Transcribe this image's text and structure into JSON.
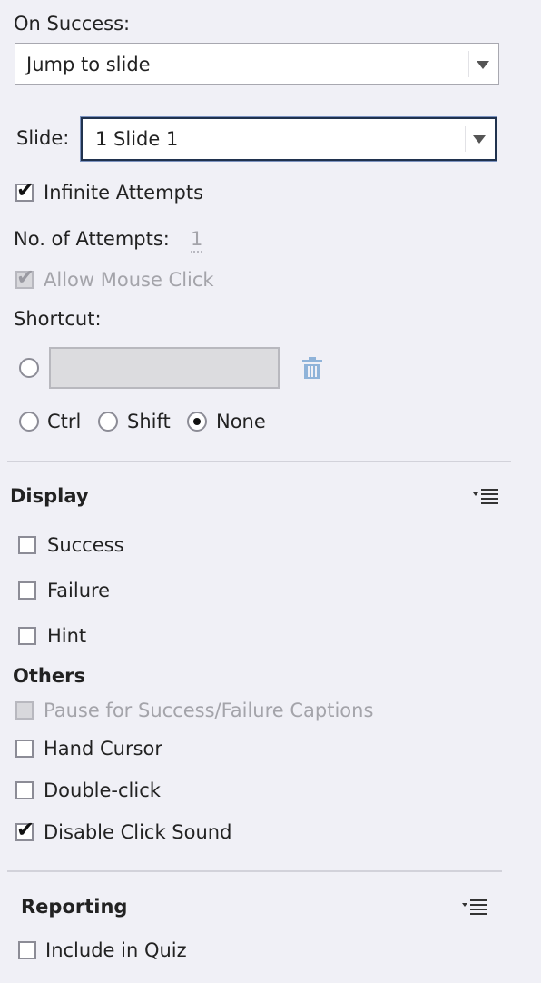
{
  "on_success": {
    "label": "On Success:",
    "value": "Jump to slide"
  },
  "slide": {
    "label": "Slide:",
    "value": "1 Slide 1"
  },
  "infinite_attempts": {
    "label": "Infinite Attempts",
    "checked": true
  },
  "attempts": {
    "label": "No. of Attempts:",
    "value": "1"
  },
  "allow_mouse_click": {
    "label": "Allow Mouse Click",
    "checked": true,
    "disabled": true
  },
  "shortcut": {
    "label": "Shortcut:",
    "key_value": "",
    "delete_icon": "trash-icon",
    "modifiers": [
      {
        "label": "Ctrl",
        "selected": false
      },
      {
        "label": "Shift",
        "selected": false
      },
      {
        "label": "None",
        "selected": true
      }
    ]
  },
  "display": {
    "title": "Display",
    "menu_icon": "panel-menu-icon",
    "items": [
      {
        "label": "Success",
        "checked": false
      },
      {
        "label": "Failure",
        "checked": false
      },
      {
        "label": "Hint",
        "checked": false
      }
    ]
  },
  "others": {
    "title": "Others",
    "items": [
      {
        "label": "Pause for Success/Failure Captions",
        "checked": false,
        "disabled": true
      },
      {
        "label": "Hand Cursor",
        "checked": false,
        "disabled": false
      },
      {
        "label": "Double-click",
        "checked": false,
        "disabled": false
      },
      {
        "label": "Disable Click Sound",
        "checked": true,
        "disabled": false
      }
    ]
  },
  "reporting": {
    "title": "Reporting",
    "menu_icon": "panel-menu-icon",
    "items": [
      {
        "label": "Include in Quiz",
        "checked": false
      }
    ]
  },
  "colors": {
    "background": "#f0f0f6",
    "focus_border": "#20324e",
    "disabled_text": "#a4a4aa",
    "trash_icon": "#8fb3d9"
  }
}
